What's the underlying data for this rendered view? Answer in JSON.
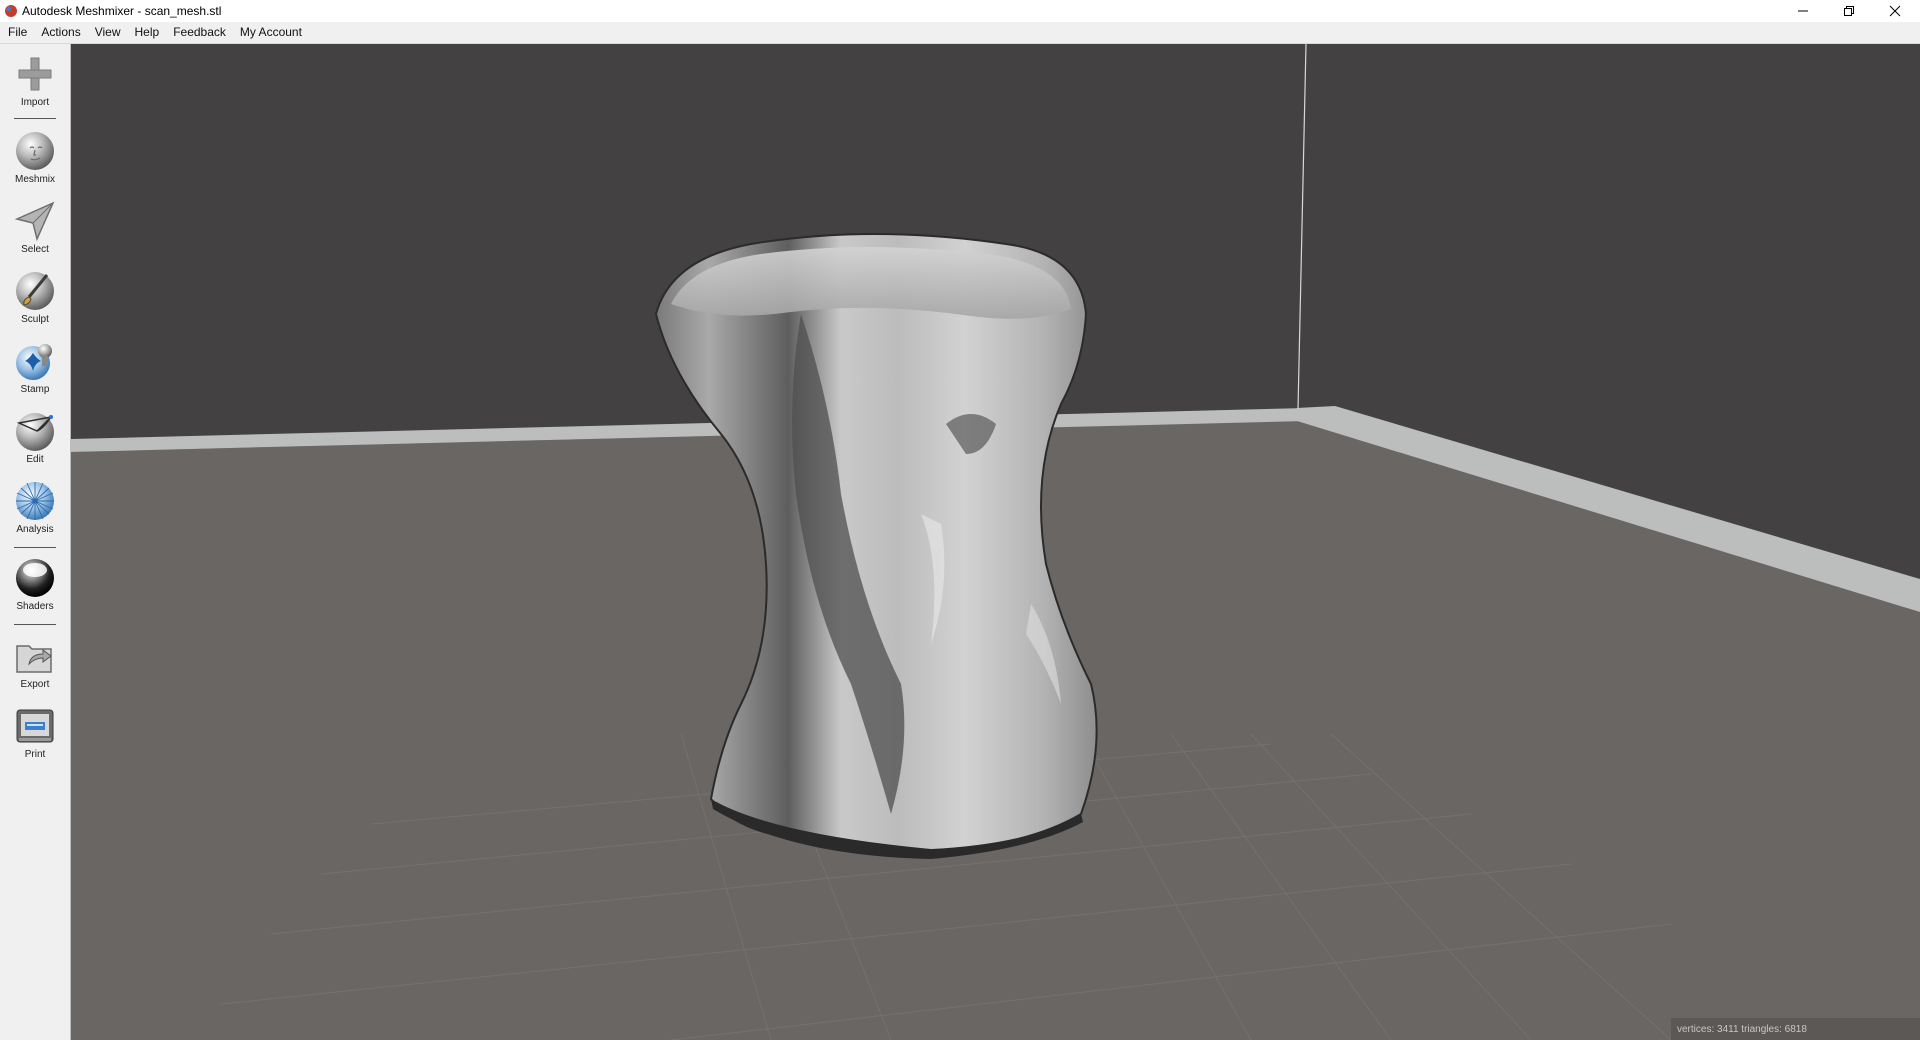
{
  "window": {
    "title": "Autodesk Meshmixer - scan_mesh.stl",
    "controls": {
      "minimize": "–",
      "restore": "❐",
      "close": "✕"
    }
  },
  "menu": [
    "File",
    "Actions",
    "View",
    "Help",
    "Feedback",
    "My Account"
  ],
  "toolbar": {
    "tools": [
      {
        "label": "Import",
        "icon": "plus-icon"
      },
      {
        "label": "Meshmix",
        "icon": "meshmix-face-icon"
      },
      {
        "label": "Select",
        "icon": "select-arrow-icon"
      },
      {
        "label": "Sculpt",
        "icon": "sculpt-brush-icon"
      },
      {
        "label": "Stamp",
        "icon": "stamp-icon"
      },
      {
        "label": "Edit",
        "icon": "edit-icon"
      },
      {
        "label": "Analysis",
        "icon": "analysis-icon"
      },
      {
        "label": "Shaders",
        "icon": "shader-sphere-icon"
      },
      {
        "label": "Export",
        "icon": "export-icon"
      },
      {
        "label": "Print",
        "icon": "printer-icon"
      }
    ]
  },
  "viewport": {
    "stats": "vertices: 3411 triangles: 6818",
    "colors": {
      "background": "#434141",
      "floor": "#696663",
      "floor_edge": "#bcbebe",
      "mesh": "#b8b8b8"
    }
  }
}
